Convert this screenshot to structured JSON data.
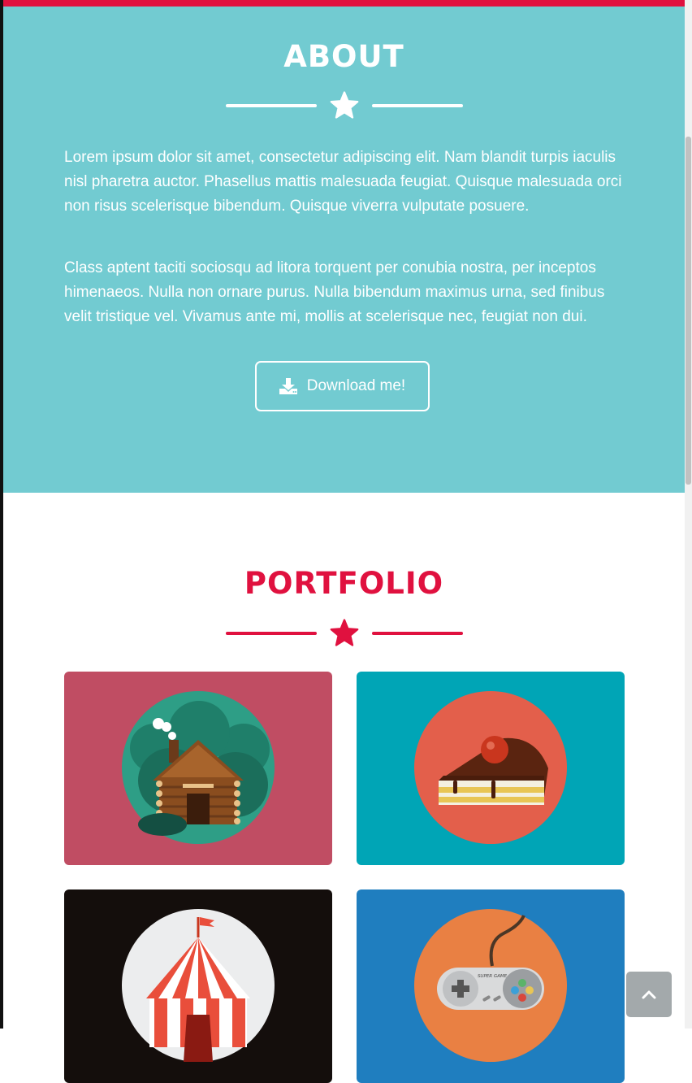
{
  "colors": {
    "accent": "#e0113f",
    "about_bg": "#72cbd1",
    "card_backgrounds": [
      "#c04d63",
      "#00a5b6",
      "#140e0c",
      "#1f7ebf"
    ]
  },
  "about": {
    "title": "ABOUT",
    "paragraphs": [
      "Lorem ipsum dolor sit amet, consectetur adipiscing elit. Nam blandit turpis iaculis nisl pharetra auctor. Phasellus mattis malesuada feugiat. Quisque malesuada orci non risus scelerisque bibendum. Quisque viverra vulputate posuere.",
      "Class aptent taciti sociosqu ad litora torquent per conubia nostra, per inceptos himenaeos. Nulla non ornare purus. Nulla bibendum maximus urna, sed finibus velit tristique vel. Vivamus ante mi, mollis at scelerisque nec, feugiat non dui."
    ],
    "download_button": {
      "label": "Download me!",
      "icon": "download-icon"
    }
  },
  "portfolio": {
    "title": "PORTFOLIO",
    "items": [
      {
        "icon": "cabin-icon",
        "bg": "#c04d63"
      },
      {
        "icon": "cake-icon",
        "bg": "#00a5b6"
      },
      {
        "icon": "circus-tent-icon",
        "bg": "#140e0c"
      },
      {
        "icon": "game-controller-icon",
        "bg": "#1f7ebf",
        "text": "SUPER GAME"
      }
    ]
  },
  "back_to_top": {
    "icon": "chevron-up-icon"
  }
}
